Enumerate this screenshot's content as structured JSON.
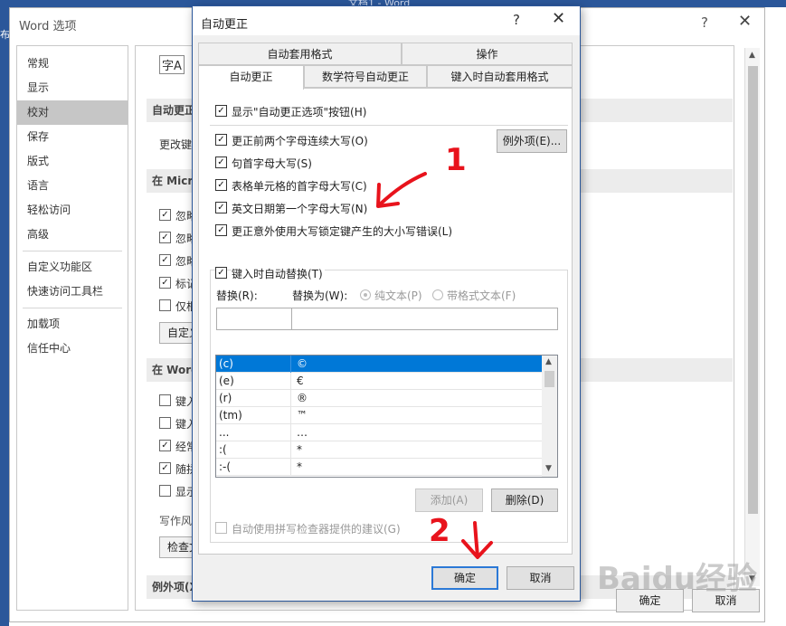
{
  "word": {
    "doc_title": "文档1 - Word",
    "left_edge_text": "布"
  },
  "options": {
    "title": "Word 选项",
    "help": "?",
    "close": "✕",
    "nav": [
      "常规",
      "显示",
      "校对",
      "保存",
      "版式",
      "语言",
      "轻松访问",
      "高级",
      "自定义功能区",
      "快速访问工具栏",
      "加载项",
      "信任中心"
    ],
    "selected_nav": "校对",
    "content": {
      "icon_text": "字A",
      "head_cut": "更",
      "section1": "自动更正",
      "change_text": "更改键入",
      "section2": "在 Micro",
      "group1": [
        "忽略",
        "忽略",
        "忽略",
        "标记",
        "仅根"
      ],
      "group1_checked": [
        true,
        true,
        true,
        true,
        false
      ],
      "custom_dict_btn": "自定义",
      "section3": "在 Word",
      "group2": [
        "键入",
        "键入",
        "经常",
        "随拼",
        "显示"
      ],
      "group2_checked": [
        false,
        false,
        true,
        true,
        false
      ],
      "style_label": "写作风",
      "check_doc_btn": "检查文",
      "section4": "例外项(X)"
    },
    "ok": "确定",
    "cancel": "取消"
  },
  "autocorrect": {
    "title": "自动更正",
    "help": "?",
    "close": "✕",
    "tabs_top": [
      "自动套用格式",
      "操作"
    ],
    "tabs_bottom": [
      "自动更正",
      "数学符号自动更正",
      "键入时自动套用格式"
    ],
    "active_tab": "自动更正",
    "show_buttons": "显示\"自动更正选项\"按钮(H)",
    "options": [
      "更正前两个字母连续大写(O)",
      "句首字母大写(S)",
      "表格单元格的首字母大写(C)",
      "英文日期第一个字母大写(N)",
      "更正意外使用大写锁定键产生的大小写错误(L)"
    ],
    "exceptions_button": "例外项(E)...",
    "replace_as_you_type": "键入时自动替换(T)",
    "replace_label": "替换(R):",
    "with_label": "替换为(W):",
    "radio_plain": "纯文本(P)",
    "radio_formatted": "带格式文本(F)",
    "entries": [
      {
        "from": "(c)",
        "to": "©"
      },
      {
        "from": "(e)",
        "to": "€"
      },
      {
        "from": "(r)",
        "to": "®"
      },
      {
        "from": "(tm)",
        "to": "™"
      },
      {
        "from": "...",
        "to": "…"
      },
      {
        "from": ":(",
        "to": "*"
      },
      {
        "from": ":-(",
        "to": "*"
      }
    ],
    "add_button": "添加(A)",
    "delete_button": "删除(D)",
    "spell_suggest": "自动使用拼写检查器提供的建议(G)",
    "ok": "确定",
    "cancel": "取消"
  },
  "annotations": {
    "mark1": "1",
    "mark2": "2",
    "color": "#e8131c"
  },
  "watermark": "Baidu经验"
}
